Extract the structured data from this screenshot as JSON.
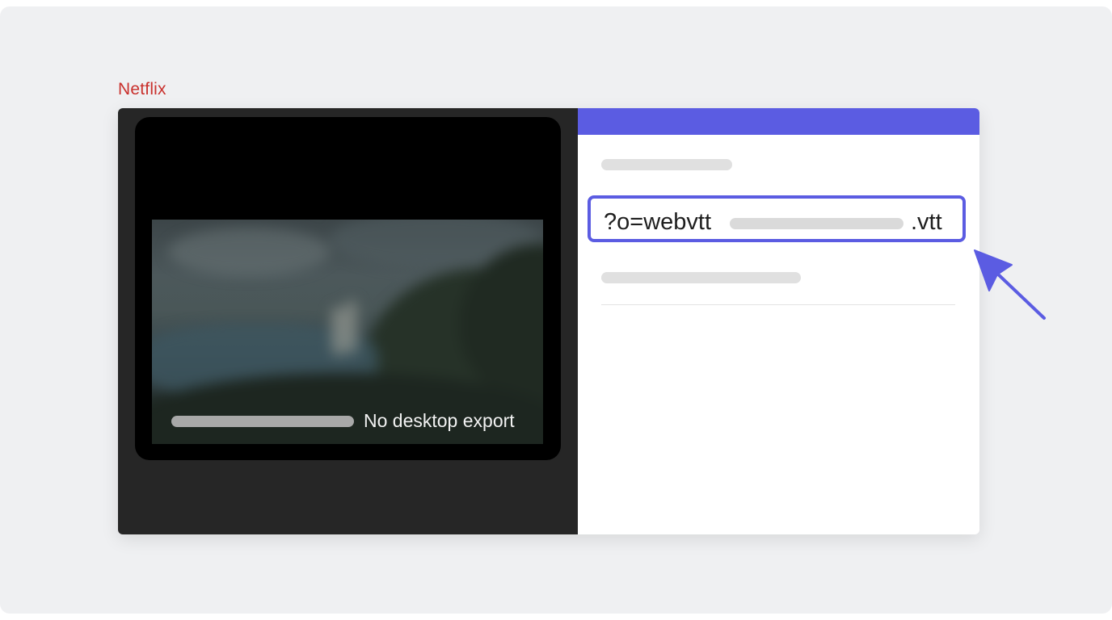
{
  "brand": {
    "label": "Netflix",
    "color": "#c9302c"
  },
  "player": {
    "export_status": "No desktop export"
  },
  "subtitle_request": {
    "url_prefix": "?o=webvtt",
    "url_suffix": ".vtt"
  },
  "colors": {
    "accent": "#5b5ce2",
    "player_bg": "#000000",
    "pane_dark": "#262626"
  },
  "icons": {
    "pointer": "arrow-pointer-icon"
  }
}
